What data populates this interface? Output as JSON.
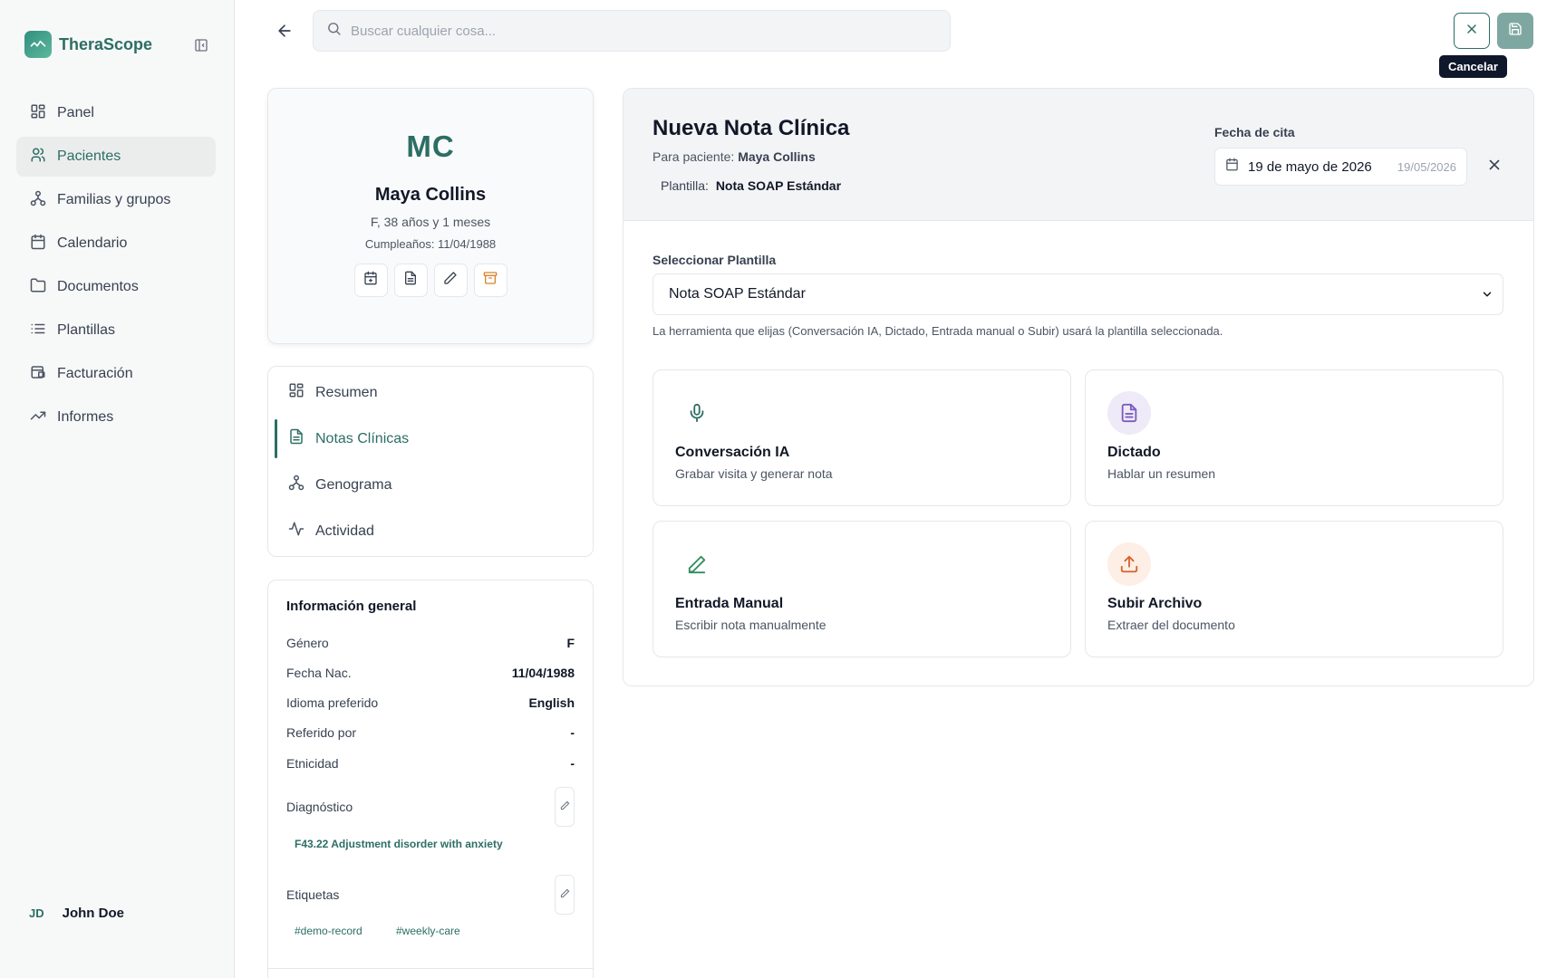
{
  "app": {
    "name": "TheraScope"
  },
  "sidebar": {
    "items": [
      {
        "label": "Panel",
        "icon": "layout-dashboard-icon",
        "active": false
      },
      {
        "label": "Pacientes",
        "icon": "users-icon",
        "active": true
      },
      {
        "label": "Familias y grupos",
        "icon": "network-icon",
        "active": false
      },
      {
        "label": "Calendario",
        "icon": "calendar-icon",
        "active": false
      },
      {
        "label": "Documentos",
        "icon": "folder-icon",
        "active": false
      },
      {
        "label": "Plantillas",
        "icon": "list-icon",
        "active": false
      },
      {
        "label": "Facturación",
        "icon": "receipt-icon",
        "active": false
      },
      {
        "label": "Informes",
        "icon": "trending-up-icon",
        "active": false
      }
    ],
    "user": {
      "initials": "JD",
      "name": "John Doe"
    }
  },
  "topbar": {
    "search_placeholder": "Buscar cualquier cosa...",
    "cancel_tooltip": "Cancelar"
  },
  "patient": {
    "initials": "MC",
    "name": "Maya Collins",
    "age": "F, 38 años y 1 meses",
    "birthday": "Cumpleaños: 11/04/1988"
  },
  "patient_tabs": [
    {
      "label": "Resumen",
      "active": false
    },
    {
      "label": "Notas Clínicas",
      "active": true
    },
    {
      "label": "Genograma",
      "active": false
    },
    {
      "label": "Actividad",
      "active": false
    }
  ],
  "general_info": {
    "title": "Información general",
    "rows": [
      {
        "label": "Género",
        "value": "F"
      },
      {
        "label": "Fecha Nac.",
        "value": "11/04/1988"
      },
      {
        "label": "Idioma preferido",
        "value": "English"
      },
      {
        "label": "Referido por",
        "value": "-"
      },
      {
        "label": "Etnicidad",
        "value": "-"
      }
    ],
    "diagnosis_label": "Diagnóstico",
    "diagnosis": "F43.22 Adjustment disorder with anxiety",
    "tags_label": "Etiquetas",
    "tags": [
      "#demo-record",
      "#weekly-care"
    ]
  },
  "note": {
    "title": "Nueva Nota Clínica",
    "for_label": "Para paciente:",
    "for_patient": "Maya Collins",
    "template_label": "Plantilla:",
    "template_name": "Nota SOAP Estándar",
    "date_label": "Fecha de cita",
    "date_value": "19 de mayo de 2026",
    "date_short": "19/05/2026",
    "select_label": "Seleccionar Plantilla",
    "select_value": "Nota SOAP Estándar",
    "select_help": "La herramienta que elijas (Conversación IA, Dictado, Entrada manual o Subir) usará la plantilla seleccionada.",
    "tools": [
      {
        "title": "Conversación IA",
        "desc": "Grabar visita y generar nota",
        "icon": "microphone-icon",
        "color": "#2c6e64",
        "bg": "#ffffff"
      },
      {
        "title": "Dictado",
        "desc": "Hablar un resumen",
        "icon": "file-text-icon",
        "color": "#7c5cbf",
        "bg": "#efeaf8"
      },
      {
        "title": "Entrada Manual",
        "desc": "Escribir nota manualmente",
        "icon": "pencil-icon",
        "color": "#2f8f5f",
        "bg": "#ffffff"
      },
      {
        "title": "Subir Archivo",
        "desc": "Extraer del documento",
        "icon": "upload-icon",
        "color": "#d9622b",
        "bg": "#fdeee6"
      }
    ]
  },
  "colors": {
    "brand": "#2c6e64",
    "sidebar_bg": "#f7f8f8"
  }
}
